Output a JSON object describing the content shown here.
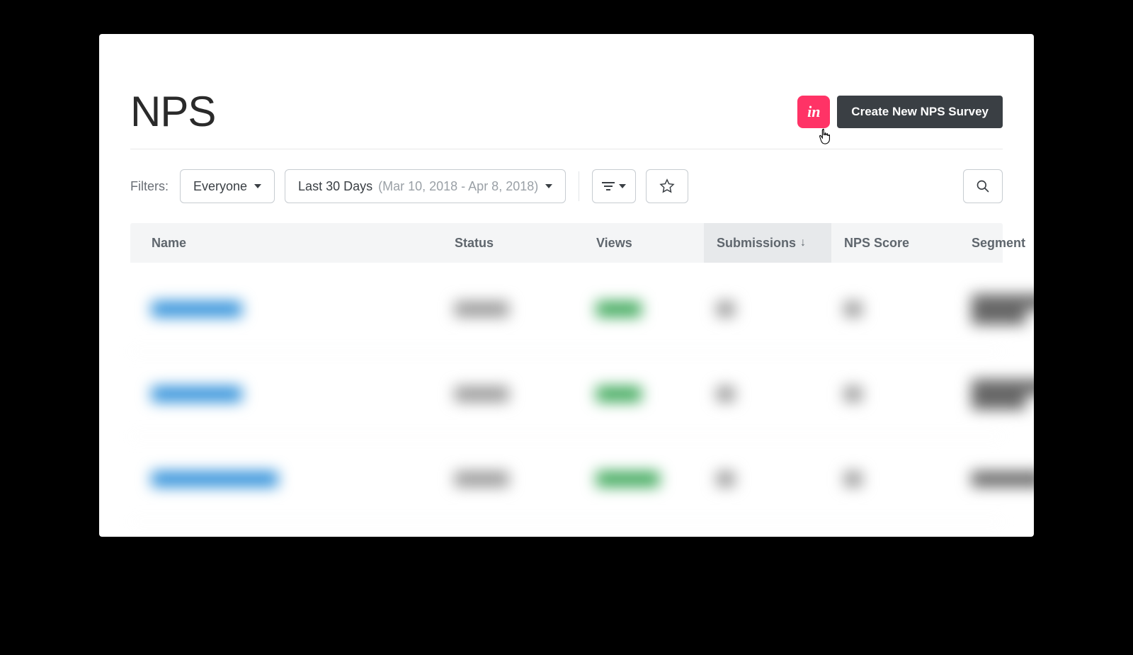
{
  "header": {
    "title": "NPS",
    "invision_label": "in",
    "create_button": "Create New NPS Survey"
  },
  "filters": {
    "label": "Filters:",
    "audience": "Everyone",
    "date_range_label": "Last 30 Days",
    "date_range_detail": "(Mar 10, 2018 - Apr 8, 2018)"
  },
  "table": {
    "columns": {
      "name": "Name",
      "status": "Status",
      "views": "Views",
      "submissions": "Submissions",
      "nps_score": "NPS Score",
      "segment": "Segment"
    },
    "sort": {
      "column": "submissions",
      "direction": "desc"
    }
  }
}
